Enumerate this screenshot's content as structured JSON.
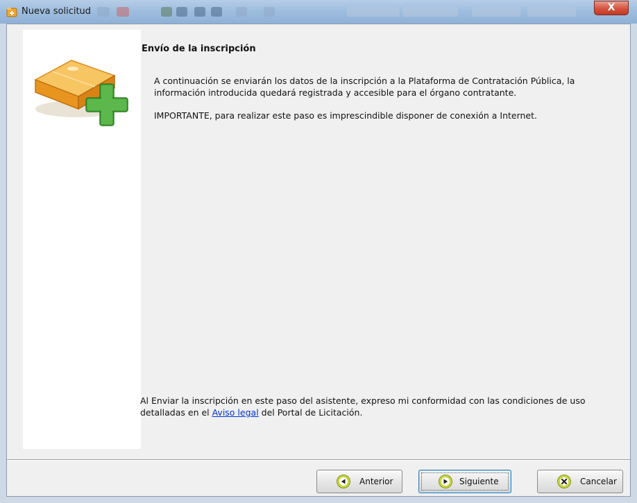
{
  "window": {
    "title": "Nueva solicitud",
    "close_label": "X"
  },
  "content": {
    "heading": "Envío de la inscripción",
    "paragraph1": "A continuación se enviarán los datos de la inscripción a la Plataforma de Contratación Pública, la información introducida quedará registrada y accesible para el órgano contratante.",
    "paragraph2": "IMPORTANTE, para realizar este paso es imprescindible disponer de conexión a Internet.",
    "legal_before": "Al Enviar la inscripción en este paso del asistente, expreso mi conformidad con las condiciones de uso detalladas en el ",
    "legal_link": "Aviso legal",
    "legal_after": " del Portal de Licitación."
  },
  "buttons": {
    "previous": "Anterior",
    "next": "Siguiente",
    "cancel": "Cancelar"
  },
  "colors": {
    "titlebar": "#9fbedf",
    "link": "#0033cc",
    "plus_green": "#4aa33a",
    "box_orange": "#f2a531"
  },
  "icons": {
    "title": "folder-add-icon",
    "wizard": "box-add-icon",
    "previous": "arrow-left-icon",
    "next": "arrow-right-icon",
    "cancel": "cancel-x-icon"
  }
}
